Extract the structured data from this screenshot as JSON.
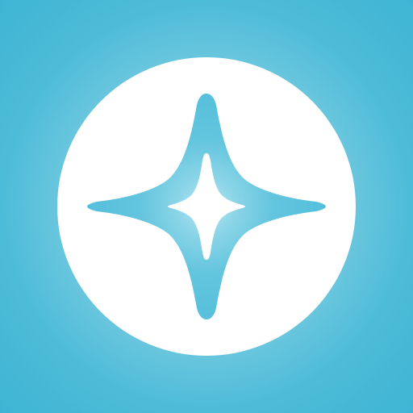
{
  "icon": {
    "name": "four-point-sparkle-logo",
    "colors": {
      "background_outer": "#3eb4d4",
      "background_inner": "#e6f6fb",
      "disc": "#ffffff",
      "star_outer": "#5fc3dd",
      "star_inner": "#ffffff"
    }
  }
}
